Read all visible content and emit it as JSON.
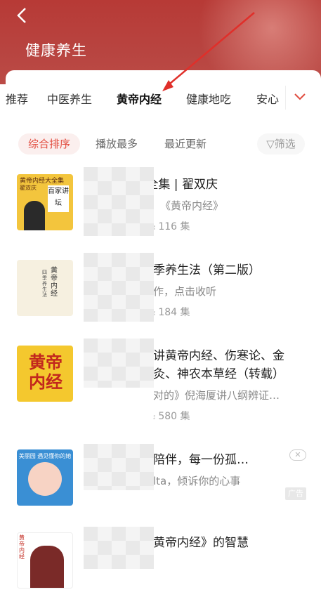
{
  "header": {
    "title": "健康养生",
    "back_icon": "chevron-left-icon"
  },
  "tabs": [
    {
      "label": "推荐",
      "active": false
    },
    {
      "label": "中医养生",
      "active": false
    },
    {
      "label": "黄帝内经",
      "active": true
    },
    {
      "label": "健康地吃",
      "active": false
    },
    {
      "label": "安心",
      "active": false
    }
  ],
  "more_tabs_icon": "chevron-down-icon",
  "sort": {
    "options": [
      "综合排序",
      "播放最多",
      "最近更新"
    ],
    "filter_label": "筛选"
  },
  "items": [
    {
      "cover_text": "黄帝内经大全集",
      "cover_sub": "翟双庆",
      "cover_badge": "百家讲坛",
      "title": "百 帝内经大全集 | 翟双庆",
      "subtitle": "《黄帝内经》",
      "count": "116 集"
    },
    {
      "cover_text": "黄帝内经",
      "cover_sub": "四季养生法",
      "title": "季养生法（第二版）",
      "subtitle": "作，点击收听",
      "count": "184 集"
    },
    {
      "cover_text": "黄帝内经",
      "title": "讲黄帝内经、伤寒论、金",
      "title2": "灸、神农本草经（转载）",
      "subtitle": "对的》倪海厦讲八纲辨证…",
      "count": "580 集"
    },
    {
      "cover_text": "美丽园 遇见懂你的她",
      "title": "陪伴，每一份孤…",
      "subtitle": "lta，倾诉你的心事",
      "ad_label": "广告",
      "ad_close": "✕"
    },
    {
      "cover_text": "黄帝内经",
      "title": "黄帝内经》的智慧"
    }
  ],
  "colors": {
    "accent": "#e04b3e",
    "header_bg": "#b73a36"
  }
}
